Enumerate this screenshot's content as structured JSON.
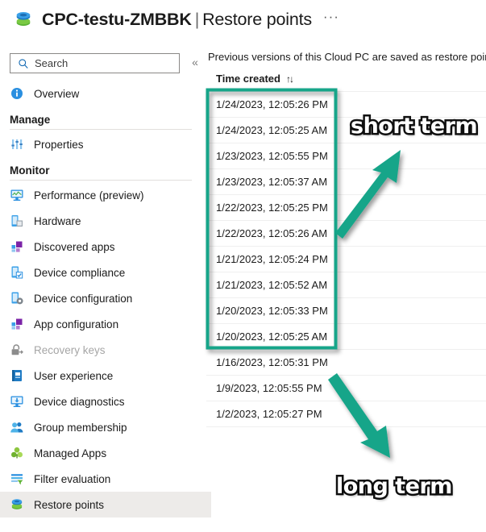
{
  "header": {
    "icon": "restore-points-icon",
    "resource_name": "CPC-testu-ZMBBK",
    "separator": "|",
    "page_name": "Restore points",
    "more_menu": "···"
  },
  "sidebar": {
    "search": {
      "placeholder": "Search",
      "value": "",
      "icon": "search-icon"
    },
    "collapse_icon": "«",
    "items": [
      {
        "label": "Overview",
        "icon": "info-icon",
        "type": "item",
        "selected": false,
        "disabled": false
      },
      {
        "label": "Manage",
        "type": "group"
      },
      {
        "label": "Properties",
        "icon": "sliders-icon",
        "type": "item",
        "selected": false,
        "disabled": false
      },
      {
        "label": "Monitor",
        "type": "group"
      },
      {
        "label": "Performance (preview)",
        "icon": "monitor-chart-icon",
        "type": "item",
        "selected": false,
        "disabled": false
      },
      {
        "label": "Hardware",
        "icon": "hardware-icon",
        "type": "item",
        "selected": false,
        "disabled": false
      },
      {
        "label": "Discovered apps",
        "icon": "apps-grid-icon",
        "type": "item",
        "selected": false,
        "disabled": false
      },
      {
        "label": "Device compliance",
        "icon": "device-check-icon",
        "type": "item",
        "selected": false,
        "disabled": false
      },
      {
        "label": "Device configuration",
        "icon": "device-gear-icon",
        "type": "item",
        "selected": false,
        "disabled": false
      },
      {
        "label": "App configuration",
        "icon": "apps-grid-icon",
        "type": "item",
        "selected": false,
        "disabled": false
      },
      {
        "label": "Recovery keys",
        "icon": "lock-key-icon",
        "type": "item",
        "selected": false,
        "disabled": true
      },
      {
        "label": "User experience",
        "icon": "book-icon",
        "type": "item",
        "selected": false,
        "disabled": false
      },
      {
        "label": "Device diagnostics",
        "icon": "monitor-download-icon",
        "type": "item",
        "selected": false,
        "disabled": false
      },
      {
        "label": "Group membership",
        "icon": "people-icon",
        "type": "item",
        "selected": false,
        "disabled": false
      },
      {
        "label": "Managed Apps",
        "icon": "clover-icon",
        "type": "item",
        "selected": false,
        "disabled": false
      },
      {
        "label": "Filter evaluation",
        "icon": "filter-list-icon",
        "type": "item",
        "selected": false,
        "disabled": false
      },
      {
        "label": "Restore points",
        "icon": "restore-points-icon",
        "type": "item",
        "selected": true,
        "disabled": false
      }
    ]
  },
  "main": {
    "description": "Previous versions of this Cloud PC are saved as restore point",
    "table": {
      "column_header": "Time created",
      "sort_icon": "↑↓",
      "rows": [
        {
          "time_created": "1/24/2023, 12:05:26 PM"
        },
        {
          "time_created": "1/24/2023, 12:05:25 AM"
        },
        {
          "time_created": "1/23/2023, 12:05:55 PM"
        },
        {
          "time_created": "1/23/2023, 12:05:37 AM"
        },
        {
          "time_created": "1/22/2023, 12:05:25 PM"
        },
        {
          "time_created": "1/22/2023, 12:05:26 AM"
        },
        {
          "time_created": "1/21/2023, 12:05:24 PM"
        },
        {
          "time_created": "1/21/2023, 12:05:52 AM"
        },
        {
          "time_created": "1/20/2023, 12:05:33 PM"
        },
        {
          "time_created": "1/20/2023, 12:05:25 AM"
        },
        {
          "time_created": "1/16/2023, 12:05:31 PM"
        },
        {
          "time_created": "1/9/2023, 12:05:55 PM"
        },
        {
          "time_created": "1/2/2023, 12:05:27 PM"
        }
      ]
    }
  },
  "annotations": {
    "accent_color": "#17a589",
    "short_term_label": "short term",
    "long_term_label": "long term",
    "highlight_box": {
      "label": "short-term-highlight-box",
      "color": "#17a589"
    },
    "arrows": [
      {
        "label": "short-term-arrow",
        "direction": "up-right"
      },
      {
        "label": "long-term-arrow",
        "direction": "down-right"
      }
    ]
  }
}
